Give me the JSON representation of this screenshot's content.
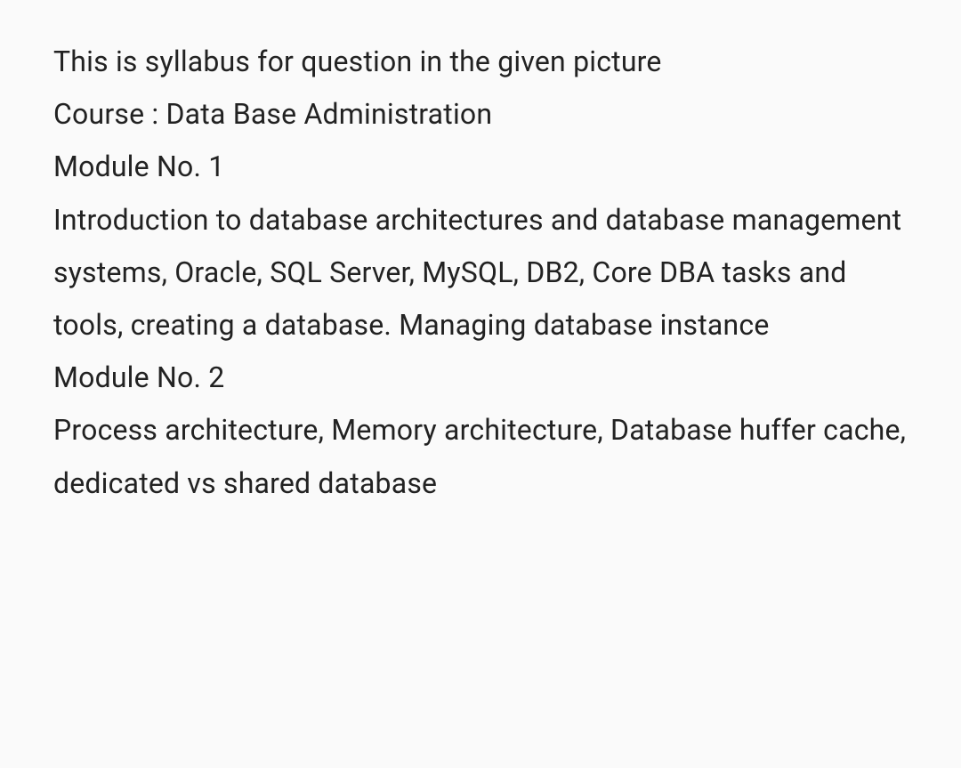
{
  "lines": {
    "intro": "This is syllabus for question in the given picture",
    "course": "Course : Data Base Administration",
    "module1_header": "Module No. 1",
    "module1_body": "Introduction to database architectures and database management systems, Oracle, SQL Server, MySQL, DB2, Core DBA tasks and tools, creating a database. Managing database instance",
    "module2_header": "Module No. 2",
    "module2_body": "Process architecture, Memory architecture, Database huffer cache, dedicated vs shared database"
  }
}
